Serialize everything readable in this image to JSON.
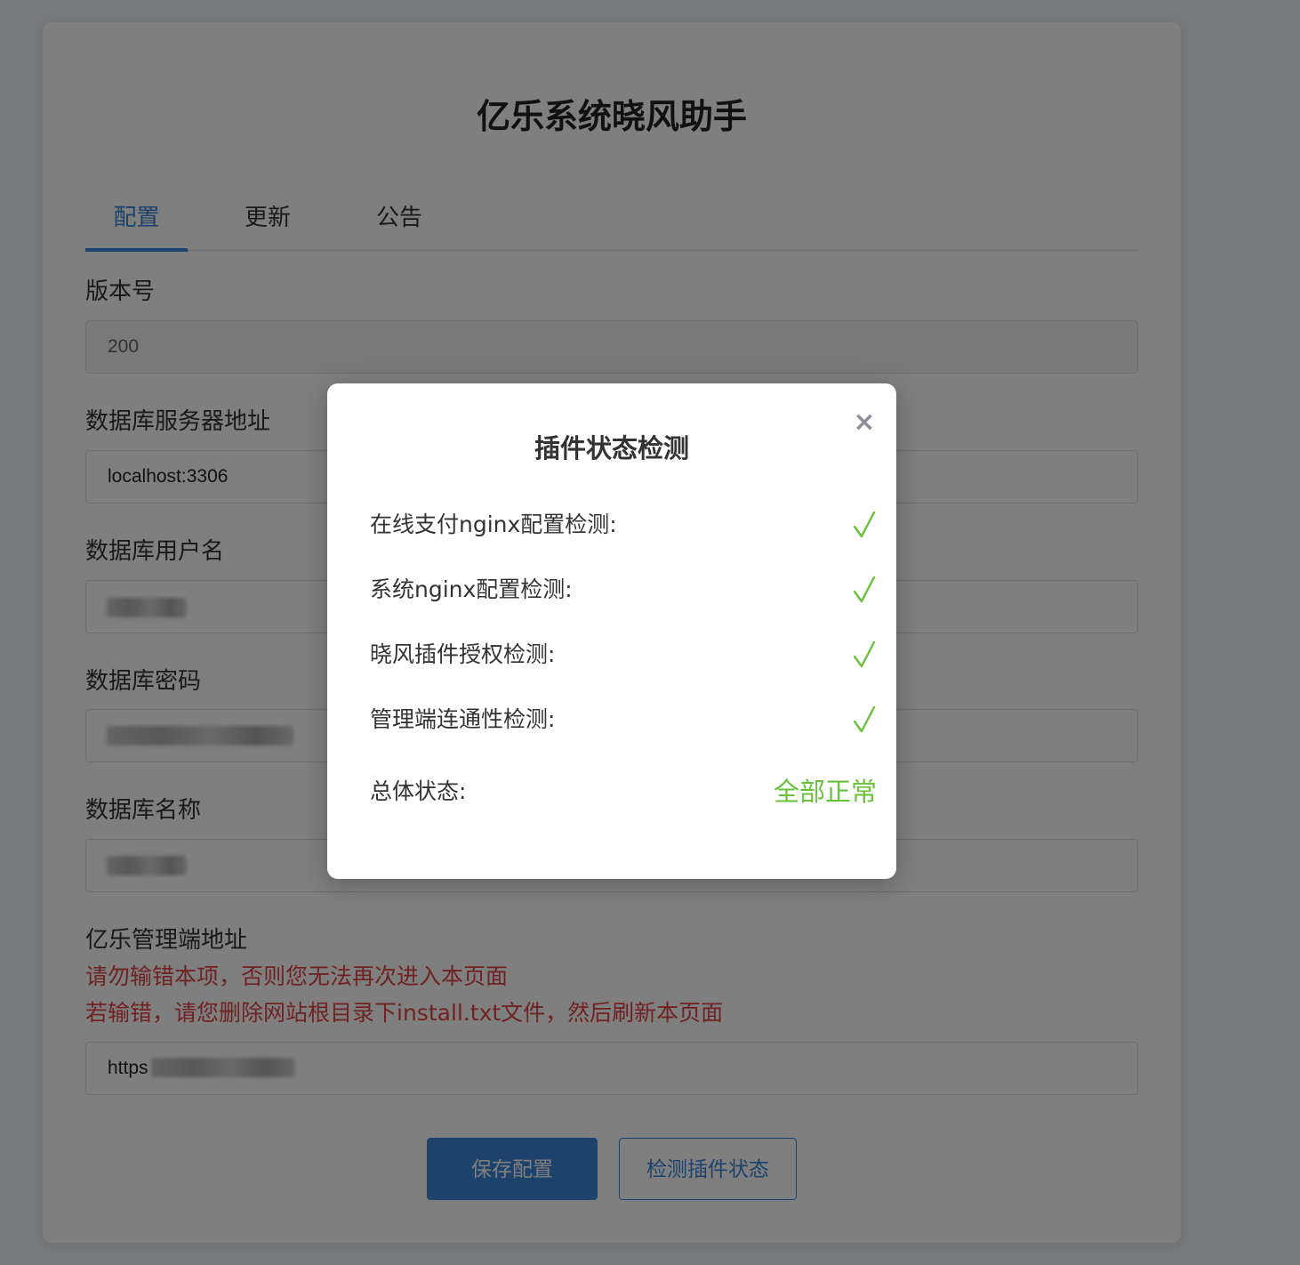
{
  "app": {
    "title": "亿乐系统晓风助手"
  },
  "tabs": [
    {
      "label": "配置",
      "active": true
    },
    {
      "label": "更新",
      "active": false
    },
    {
      "label": "公告",
      "active": false
    }
  ],
  "form": {
    "version": {
      "label": "版本号",
      "value": "200"
    },
    "db_host": {
      "label": "数据库服务器地址",
      "value": "localhost:3306"
    },
    "db_user": {
      "label": "数据库用户名",
      "value": ""
    },
    "db_password": {
      "label": "数据库密码",
      "value": ""
    },
    "db_name": {
      "label": "数据库名称",
      "value": ""
    },
    "admin_url": {
      "label": "亿乐管理端地址",
      "warning_1": "请勿输错本项，否则您无法再次进入本页面",
      "warning_2": "若输错，请您删除网站根目录下install.txt文件，然后刷新本页面",
      "value": "https"
    }
  },
  "buttons": {
    "save": "保存配置",
    "check": "检测插件状态"
  },
  "modal": {
    "title": "插件状态检测",
    "close": "×",
    "checks": [
      {
        "label": "在线支付nginx配置检测:",
        "status": "ok"
      },
      {
        "label": "系统nginx配置检测:",
        "status": "ok"
      },
      {
        "label": "晓风插件授权检测:",
        "status": "ok"
      },
      {
        "label": "管理端连通性检测:",
        "status": "ok"
      }
    ],
    "overall": {
      "label": "总体状态:",
      "value": "全部正常"
    }
  },
  "colors": {
    "accent": "#3a85d6",
    "success": "#67c23a",
    "warning": "#e04545"
  }
}
